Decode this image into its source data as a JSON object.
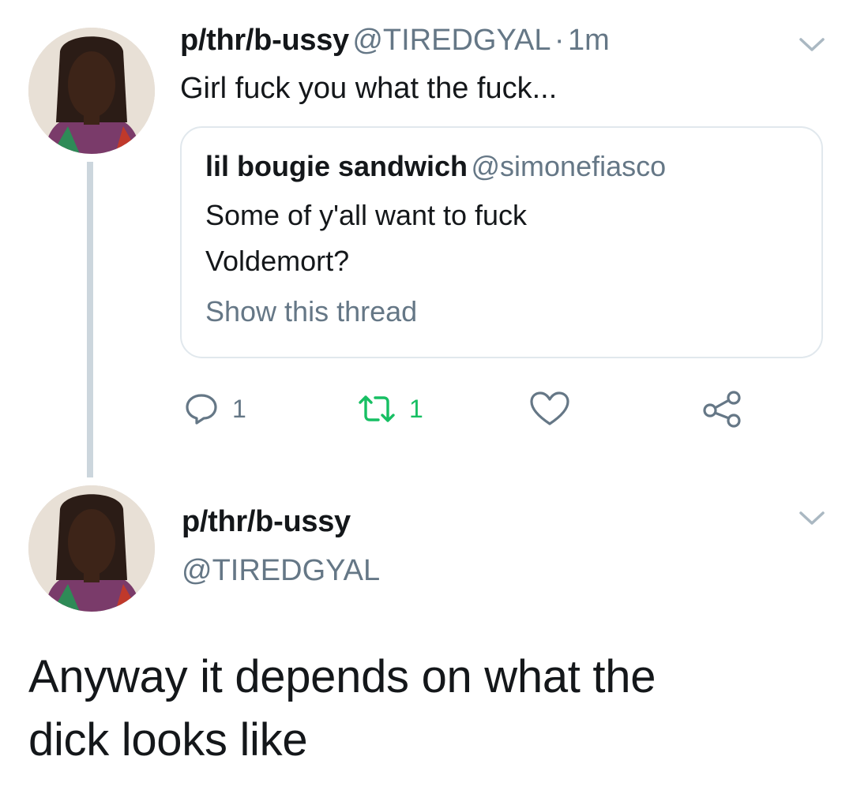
{
  "tweet1": {
    "display_name": "p/thr/b-ussy",
    "handle": "@TIREDGYAL",
    "separator": "·",
    "time": "1m",
    "text": "Girl fuck you what the fuck...",
    "quoted": {
      "display_name": "lil bougie sandwich",
      "handle": "@simonefiasco",
      "text_line1": "Some of y'all want to fuck",
      "text_line2": "Voldemort?",
      "show_thread": "Show this thread"
    },
    "actions": {
      "reply_count": "1",
      "retweet_count": "1"
    }
  },
  "tweet2": {
    "display_name": "p/thr/b-ussy",
    "handle": "@TIREDGYAL",
    "text_line1": "Anyway it depends on what the",
    "text_line2": "dick looks like"
  },
  "icons": {
    "reply": "reply-icon",
    "retweet": "retweet-icon",
    "like": "heart-icon",
    "share": "share-icon",
    "menu": "chevron-down-icon"
  },
  "colors": {
    "text": "#14171a",
    "secondary": "#657786",
    "retweet_green": "#17bf63",
    "border": "#e1e8ed",
    "thread_line": "#ccd6dd"
  }
}
